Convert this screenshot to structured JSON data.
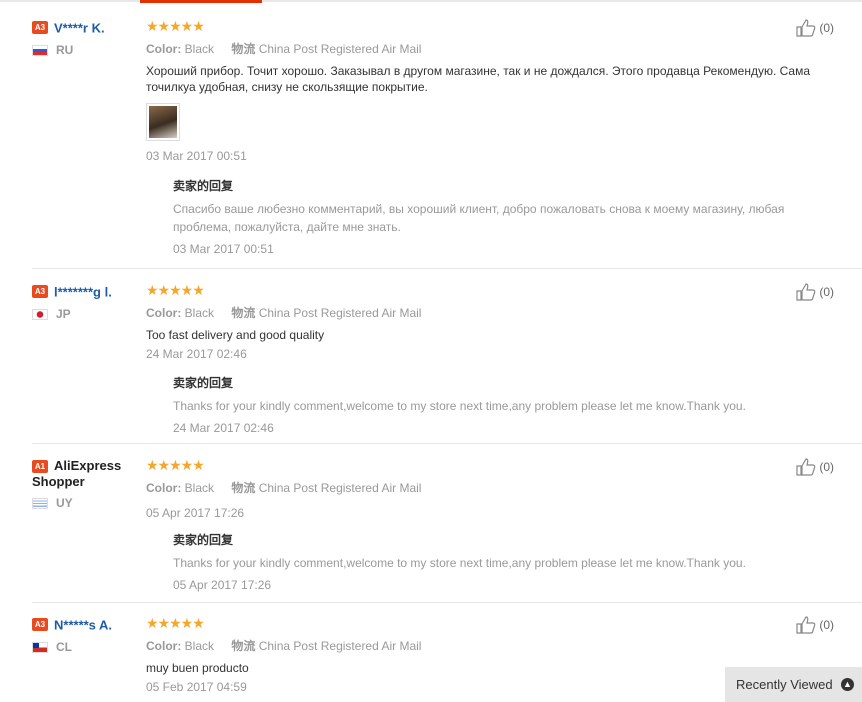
{
  "reviews": [
    {
      "level": "A3",
      "name": "V****r K.",
      "country": "RU",
      "color_label": "Color:",
      "color_value": "Black",
      "shipping_label": "物流",
      "shipping_value": "China Post Registered Air Mail",
      "comment": "Хороший прибор. Точит хорошо. Заказывал в другом магазине, так и не дождался. Этого продавца Рекомендую. Сама точилкуа удобная, снизу не скользящие покрытие.",
      "date": "03 Mar 2017 00:51",
      "reply_title": "卖家的回复",
      "reply_text": "Спасибо ваше любезно комментарий, вы хороший клиент, добро пожаловать снова к моему магазину, любая проблема, пожалуйста, дайте мне знать.",
      "reply_date": "03 Mar 2017 00:51",
      "helpful": "(0)",
      "stars": "★★★★★"
    },
    {
      "level": "A3",
      "name": "l*******g l.",
      "country": "JP",
      "color_label": "Color:",
      "color_value": "Black",
      "shipping_label": "物流",
      "shipping_value": "China Post Registered Air Mail",
      "comment": "Too fast delivery and good quality",
      "date": "24 Mar 2017 02:46",
      "reply_title": "卖家的回复",
      "reply_text": "Thanks for your kindly comment,welcome to my store next time,any problem please let me know.Thank you.",
      "reply_date": "24 Mar 2017 02:46",
      "helpful": "(0)",
      "stars": "★★★★★"
    },
    {
      "level": "A1",
      "name": "AliExpress Shopper",
      "country": "UY",
      "color_label": "Color:",
      "color_value": "Black",
      "shipping_label": "物流",
      "shipping_value": "China Post Registered Air Mail",
      "date": "05 Apr 2017 17:26",
      "reply_title": "卖家的回复",
      "reply_text": "Thanks for your kindly comment,welcome to my store next time,any problem please let me know.Thank you.",
      "reply_date": "05 Apr 2017 17:26",
      "helpful": "(0)",
      "stars": "★★★★★"
    },
    {
      "level": "A3",
      "name": "N*****s A.",
      "country": "CL",
      "color_label": "Color:",
      "color_value": "Black",
      "shipping_label": "物流",
      "shipping_value": "China Post Registered Air Mail",
      "comment": "muy buen producto",
      "date": "05 Feb 2017 04:59",
      "helpful": "(0)",
      "stars": "★★★★★"
    }
  ],
  "recently_viewed": "Recently Viewed",
  "colors": {
    "accent": "#e62e04",
    "star": "#f4a72b",
    "name": "#1e5ba6",
    "badge": "#e84b20"
  }
}
